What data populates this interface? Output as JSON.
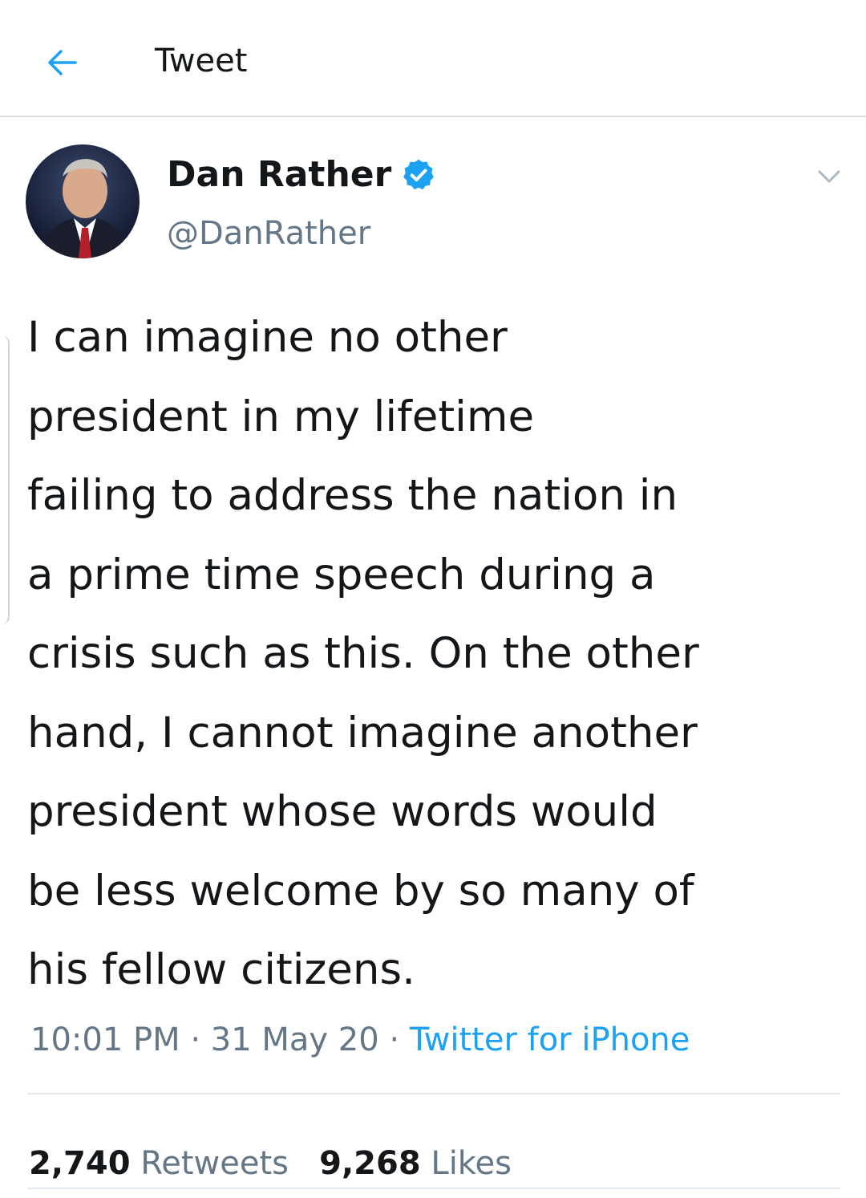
{
  "header": {
    "back_icon": "arrow-left-icon",
    "title": "Tweet"
  },
  "tweet": {
    "display_name": "Dan Rather",
    "verified_icon": "verified-badge-icon",
    "handle": "@DanRather",
    "menu_icon": "chevron-down-icon",
    "text_lines": [
      "I can imagine no other",
      "president in my lifetime",
      "failing to address the nation in",
      "a prime time speech during a",
      "crisis such as this. On the other",
      "hand, I cannot imagine another",
      "president whose words would",
      "be less welcome by so many of",
      "his fellow citizens."
    ],
    "time": "10:01 PM",
    "date": "31 May 20",
    "separator": "·",
    "source": "Twitter for iPhone"
  },
  "stats": {
    "retweets_count": "2,740",
    "retweets_label": "Retweets",
    "likes_count": "9,268",
    "likes_label": "Likes"
  },
  "colors": {
    "accent": "#1da1f2",
    "secondary_text": "#657786",
    "primary_text": "#14171a"
  }
}
